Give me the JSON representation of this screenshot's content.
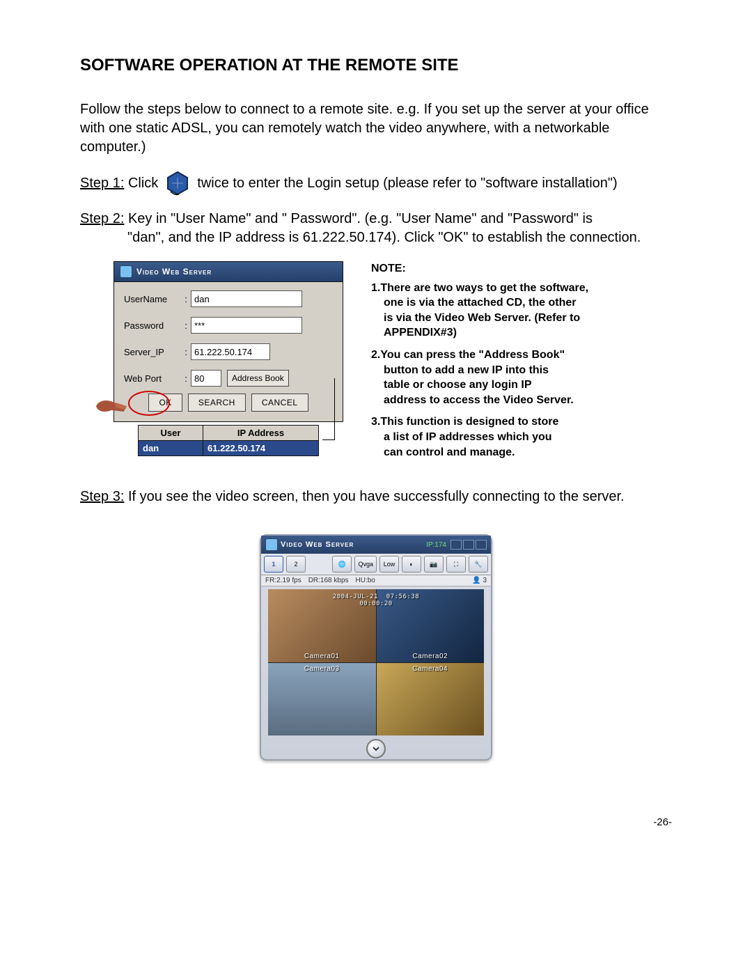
{
  "heading": "SOFTWARE OPERATION AT THE REMOTE SITE",
  "intro": "Follow  the steps below to connect to a remote site.  e.g.  If you set up the server at your office with one static ADSL, you can remotely watch the video anywhere, with a networkable computer.)",
  "step1": {
    "label": "Step 1:",
    "before_icon": "  Click",
    "after_icon": "twice to enter the Login setup (please refer to \"software installation\")"
  },
  "step2": {
    "label": "Step 2:",
    "line1": "  Key in \"User Name\" and \" Password\".  (e.g. \"User Name\" and \"Password\" is",
    "line2": "\"dan\", and the IP address is 61.222.50.174). Click \"OK\" to establish the connection."
  },
  "login_dialog": {
    "title": "Video Web Server",
    "fields": {
      "user_label": "UserName",
      "user_value": "dan",
      "pwd_label": "Password",
      "pwd_value": "***",
      "ip_label": "Server_IP",
      "ip_value": "61.222.50.174",
      "port_label": "Web Port",
      "port_value": "80",
      "address_book_btn": "Address Book"
    },
    "buttons": {
      "ok": "OK",
      "search": "SEARCH",
      "cancel": "CANCEL"
    },
    "table": {
      "headers": {
        "user": "User",
        "ip": "IP Address"
      },
      "row": {
        "user": "dan",
        "ip": "61.222.50.174"
      }
    }
  },
  "note": {
    "title": "NOTE:",
    "item1_head": "1.There are two ways to get the software,",
    "item1_a": "one is via the attached CD,  the other",
    "item1_b": "is via the Video Web Server. (Refer to",
    "item1_c": "APPENDIX#3)",
    "item2_head": "2.You can press the \"Address Book\"",
    "item2_a": "button to add a new IP into this",
    "item2_b": "table or choose any login IP",
    "item2_c": "address to access the Video Server.",
    "item3_head": "3.This function is designed to store",
    "item3_a": "a list of IP addresses which you",
    "item3_b": "can control and manage."
  },
  "step3": {
    "label": "Step 3:",
    "text": "  If you see the video screen, then you have successfully connecting to the server."
  },
  "viewer": {
    "title": "Video Web Server",
    "ip_tag": "IP:174",
    "toolbar_labels": {
      "view1": "1",
      "view2": "2",
      "qvga": "Qvga",
      "low": "Low"
    },
    "status": {
      "fr": "FR:2.19 fps",
      "dr": "DR:168 kbps",
      "hu": "HU:bo",
      "users": "3"
    },
    "timestamp_date": "2004-JUL-21",
    "timestamp_time": "07:56:38",
    "timestamp_sub": "00:00:20",
    "cam1": "Camera01",
    "cam2": "Camera02",
    "cam3": "Camera03",
    "cam4": "Camera04"
  },
  "page_number": "-26-"
}
